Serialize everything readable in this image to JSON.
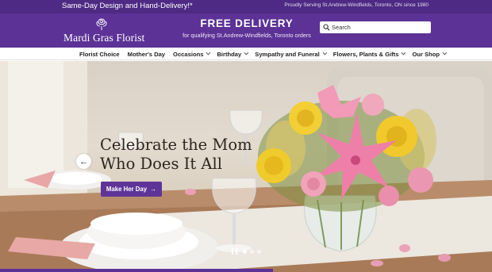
{
  "topbar": {
    "promo": "Same-Day Design and Hand-Delivery!*",
    "serving": "Proudly Serving St.Andrew-Windfields, Toronto, ON since 1980"
  },
  "header": {
    "logo_text": "Mardi Gras Florist",
    "delivery_title": "FREE DELIVERY",
    "delivery_sub": "for qualifying St.Andrew-Windfields, Toronto orders",
    "search_placeholder": "Search"
  },
  "nav": {
    "items": [
      {
        "label": "Florist Choice"
      },
      {
        "label": "Mother's Day"
      },
      {
        "label": "Occasions"
      },
      {
        "label": "Birthday"
      },
      {
        "label": "Sympathy and Funeral"
      },
      {
        "label": "Flowers, Plants & Gifts"
      },
      {
        "label": "Our Shop"
      }
    ]
  },
  "hero": {
    "headline_line1": "Celebrate the Mom",
    "headline_line2": "Who Does It All",
    "cta_label": "Make Her Day",
    "cta_arrow": "→",
    "prev_arrow": "←",
    "slide_count": 3,
    "active_slide": 1
  },
  "colors": {
    "brand_purple": "#5c3296",
    "topbar_purple": "#4e2a84",
    "cta_purple": "#5e3597"
  },
  "icons": [
    "rose-logo-icon",
    "search-icon",
    "chevron-down-icon",
    "arrow-left-icon",
    "arrow-right-icon",
    "pause-icon"
  ]
}
